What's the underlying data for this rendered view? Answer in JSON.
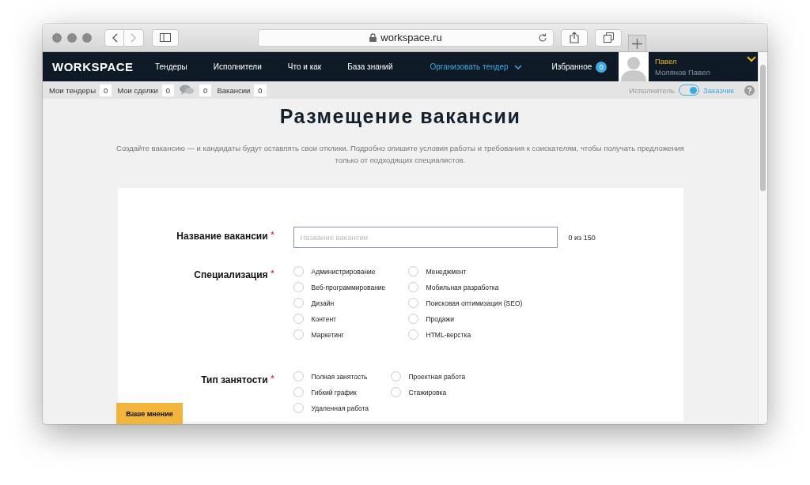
{
  "browser": {
    "url": "workspace.ru"
  },
  "nav": {
    "logo": "WORKSPACE",
    "items": [
      {
        "label": "Тендеры",
        "kind": "link"
      },
      {
        "label": "Исполнители",
        "kind": "link"
      },
      {
        "label": "Что и как",
        "kind": "link"
      },
      {
        "label": "База знаний",
        "kind": "link"
      },
      {
        "label": "Организовать тендер",
        "kind": "dropdown"
      }
    ],
    "favorites": {
      "label": "Избранное",
      "count": "0"
    },
    "user": {
      "first_name": "Павел",
      "full_name": "Молянов Павел"
    }
  },
  "counters": [
    {
      "kind": "text",
      "label": "Мои тендеры",
      "count": "0"
    },
    {
      "kind": "text",
      "label": "Мои сделки",
      "count": "0"
    },
    {
      "kind": "chat",
      "count": "0"
    },
    {
      "kind": "text",
      "label": "Вакансии",
      "count": "0"
    }
  ],
  "role_switch": {
    "left_label": "Исполнитель",
    "right_label": "Заказчик",
    "on": true
  },
  "page": {
    "title": "Размещение вакансии",
    "intro": "Создайте вакансию — и кандидаты будут оставлять свои отклики. Подробно опишите условия работы и требования к соискателям, чтобы получать предложения только от подходящих специалистов."
  },
  "form": {
    "name_field": {
      "label": "Название вакансии",
      "required_mark": "*",
      "placeholder": "Название вакансии",
      "counter": "0 из 150"
    },
    "specialization": {
      "label": "Специализация",
      "required_mark": "*",
      "columns": [
        [
          {
            "label": "Администрирование",
            "selected": false
          },
          {
            "label": "Веб-программирование",
            "selected": false
          },
          {
            "label": "Дизайн",
            "selected": false
          },
          {
            "label": "Контент",
            "selected": false
          },
          {
            "label": "Маркетинг",
            "selected": false
          }
        ],
        [
          {
            "label": "Менеджмент",
            "selected": false
          },
          {
            "label": "Мобильная разработка",
            "selected": false
          },
          {
            "label": "Поисковая оптимизация (SEO)",
            "selected": false
          },
          {
            "label": "Продажи",
            "selected": false
          },
          {
            "label": "HTML-верстка",
            "selected": false
          }
        ]
      ]
    },
    "employment": {
      "label": "Тип занятости",
      "required_mark": "*",
      "columns": [
        [
          {
            "label": "Полная занятость",
            "selected": false
          },
          {
            "label": "Гибкий график",
            "selected": false
          },
          {
            "label": "Удаленная работа",
            "selected": false
          }
        ],
        [
          {
            "label": "Проектная работа",
            "selected": false
          },
          {
            "label": "Стажировка",
            "selected": false
          }
        ]
      ]
    }
  },
  "feedback_button": "Ваше мнение"
}
